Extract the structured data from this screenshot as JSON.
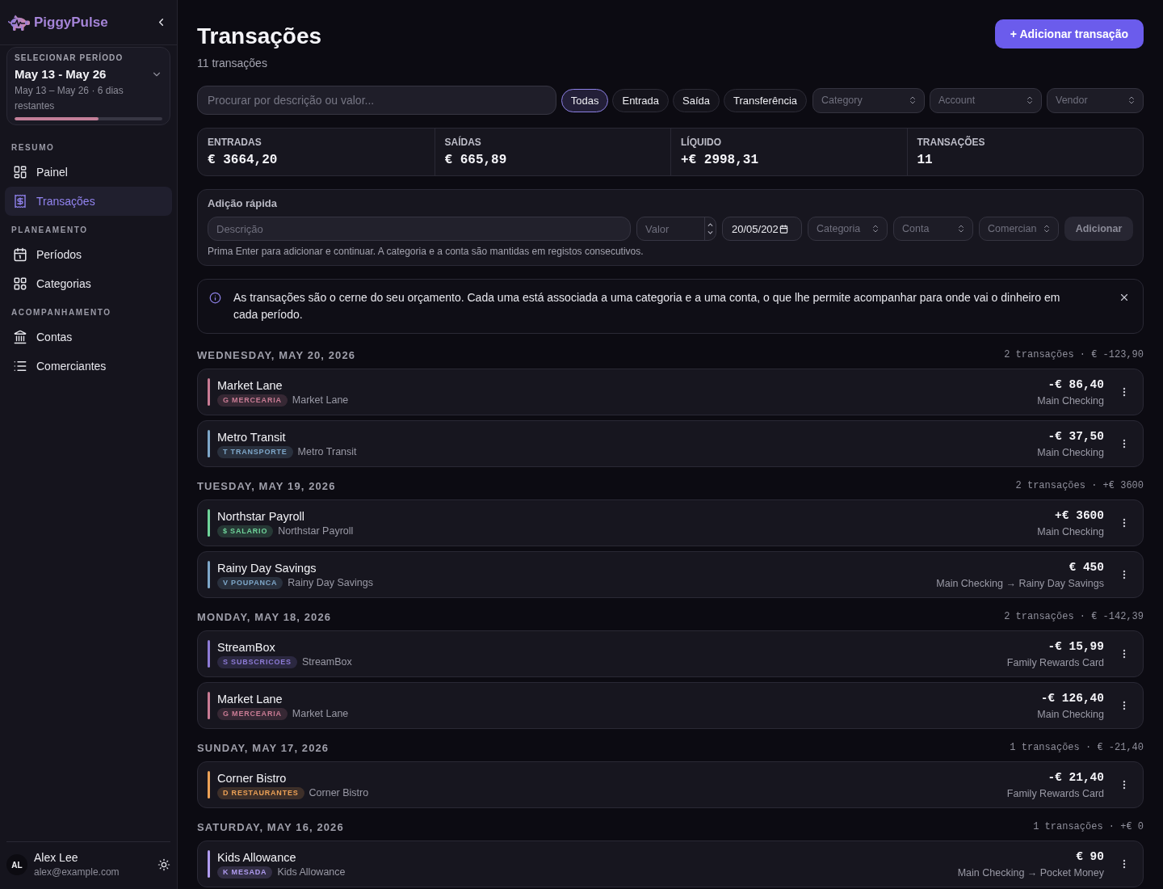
{
  "sidebar": {
    "brand": "PiggyPulse",
    "period": {
      "label": "SELECIONAR PERÍODO",
      "range": "May 13 - May 26",
      "detail": "May 13 – May 26 · 6 dias restantes",
      "level": 0.57
    },
    "sections": [
      {
        "title": "RESUMO",
        "items": [
          {
            "label": "Painel",
            "selected": false
          },
          {
            "label": "Transações",
            "selected": true
          }
        ]
      },
      {
        "title": "PLANEAMENTO",
        "items": [
          {
            "label": "Períodos",
            "selected": false
          },
          {
            "label": "Categorias",
            "selected": false
          }
        ]
      },
      {
        "title": "ACOMPANHAMENTO",
        "items": [
          {
            "label": "Contas",
            "selected": false
          },
          {
            "label": "Comerciantes",
            "selected": false
          }
        ]
      }
    ],
    "user": {
      "initials": "AL",
      "name": "Alex Lee",
      "email": "alex@example.com"
    }
  },
  "header": {
    "title": "Transações",
    "count": "11 transações",
    "add_button": "+ Adicionar transação"
  },
  "filters": {
    "search": {
      "placeholder": "Procurar por descrição ou valor..."
    },
    "types": [
      {
        "label": "Todas",
        "selected": true
      },
      {
        "label": "Entrada",
        "selected": false
      },
      {
        "label": "Saída",
        "selected": false
      },
      {
        "label": "Transferência",
        "selected": false
      }
    ],
    "selects": [
      {
        "placeholder": "Category"
      },
      {
        "placeholder": "Account"
      },
      {
        "placeholder": "Vendor"
      }
    ]
  },
  "summary": [
    {
      "label": "ENTRADAS",
      "value": "€ 3664,20"
    },
    {
      "label": "SAÍDAS",
      "value": "€ 665,89"
    },
    {
      "label": "LÍQUIDO",
      "value": "+€ 2998,31"
    },
    {
      "label": "TRANSAÇÕES",
      "value": "11"
    }
  ],
  "quick_add": {
    "title": "Adição rápida",
    "description": {
      "placeholder": "Descrição"
    },
    "amount": {
      "placeholder": "Valor"
    },
    "date": {
      "value": "20/05/202"
    },
    "selects": [
      {
        "placeholder": "Categoria"
      },
      {
        "placeholder": "Conta"
      },
      {
        "placeholder": "Comercian"
      }
    ],
    "submit": {
      "label": "Adicionar",
      "disabled": true
    },
    "hint": "Prima Enter para adicionar e continuar. A categoria e a conta são mantidas em registos consecutivos."
  },
  "notice": {
    "text": "As transações são o cerne do seu orçamento. Cada uma está associada a uma categoria e a uma conta, o que lhe permite acompanhar para onde vai o dinheiro em cada período."
  },
  "groups": [
    {
      "date": "WEDNESDAY, MAY 20, 2026",
      "summary": "2 transações · € -123,90",
      "transactions": [
        {
          "title": "Market Lane",
          "category": "G MERCEARIA",
          "vendor": "Market Lane",
          "amount": "-€ 86,40",
          "account": "Main Checking",
          "color": "#c97b94"
        },
        {
          "title": "Metro Transit",
          "category": "T TRANSPORTE",
          "vendor": "Metro Transit",
          "amount": "-€ 37,50",
          "account": "Main Checking",
          "color": "#7ea7c9"
        }
      ]
    },
    {
      "date": "TUESDAY, MAY 19, 2026",
      "summary": "2 transações · +€ 3600",
      "transactions": [
        {
          "title": "Northstar Payroll",
          "category": "$ SALARIO",
          "vendor": "Northstar Payroll",
          "amount": "+€ 3600",
          "account": "Main Checking",
          "color": "#6fd49a"
        },
        {
          "title": "Rainy Day Savings",
          "category": "V POUPANCA",
          "vendor": "Rainy Day Savings",
          "amount": "€ 450",
          "account": "Main Checking → Rainy Day Savings",
          "color": "#7ea7c9"
        }
      ]
    },
    {
      "date": "MONDAY, MAY 18, 2026",
      "summary": "2 transações · € -142,39",
      "transactions": [
        {
          "title": "StreamBox",
          "category": "S SUBSCRICOES",
          "vendor": "StreamBox",
          "amount": "-€ 15,99",
          "account": "Family Rewards Card",
          "color": "#8d7bd6"
        },
        {
          "title": "Market Lane",
          "category": "G MERCEARIA",
          "vendor": "Market Lane",
          "amount": "-€ 126,40",
          "account": "Main Checking",
          "color": "#c97b94"
        }
      ]
    },
    {
      "date": "SUNDAY, MAY 17, 2026",
      "summary": "1 transações · € -21,40",
      "transactions": [
        {
          "title": "Corner Bistro",
          "category": "D RESTAURANTES",
          "vendor": "Corner Bistro",
          "amount": "-€ 21,40",
          "account": "Family Rewards Card",
          "color": "#eca156"
        }
      ]
    },
    {
      "date": "SATURDAY, MAY 16, 2026",
      "summary": "1 transações · +€ 0",
      "transactions": [
        {
          "title": "Kids Allowance",
          "category": "K MESADA",
          "vendor": "Kids Allowance",
          "amount": "€ 90",
          "account": "Main Checking → Pocket Money",
          "color": "#b09cf0"
        }
      ]
    }
  ]
}
